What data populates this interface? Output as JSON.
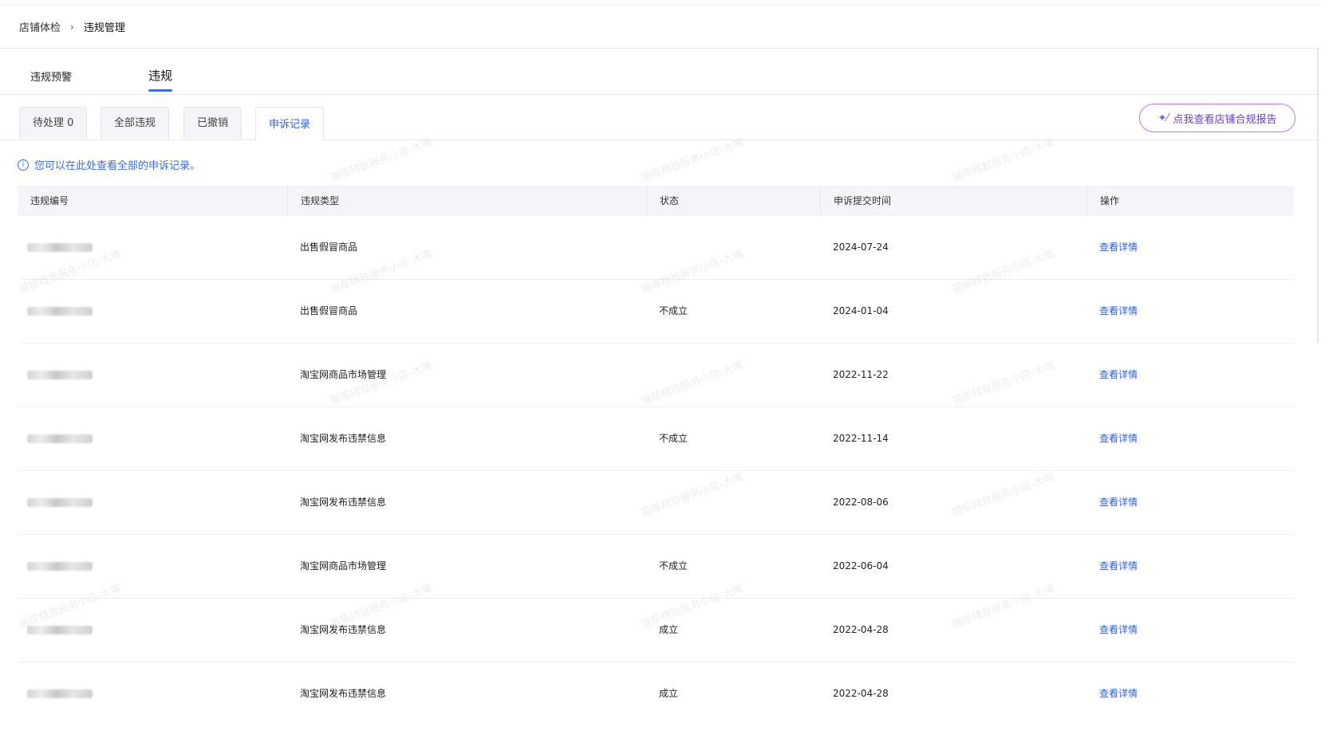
{
  "breadcrumb": {
    "item1": "店铺体检",
    "separator": "›",
    "item2": "违规管理"
  },
  "main_tabs": {
    "tab1": "违规预警",
    "tab2": "违规"
  },
  "sub_tabs": {
    "pending": "待处理 0",
    "all": "全部违规",
    "revoked": "已撤销",
    "appeals": "申诉记录"
  },
  "report_button": {
    "icon": "sparkle-icon",
    "label": "点我查看店铺合规报告"
  },
  "notice": {
    "icon": "info-icon",
    "text": "您可以在此处查看全部的申诉记录。"
  },
  "table": {
    "headers": [
      "违规编号",
      "违规类型",
      "状态",
      "申诉提交时间",
      "操作"
    ],
    "rows": [
      {
        "type": "出售假冒商品",
        "status": "",
        "time": "2024-07-24",
        "action": "查看详情"
      },
      {
        "type": "出售假冒商品",
        "status": "不成立",
        "time": "2024-01-04",
        "action": "查看详情"
      },
      {
        "type": "淘宝网商品市场管理",
        "status": "",
        "time": "2022-11-22",
        "action": "查看详情"
      },
      {
        "type": "淘宝网发布违禁信息",
        "status": "不成立",
        "time": "2022-11-14",
        "action": "查看详情"
      },
      {
        "type": "淘宝网发布违禁信息",
        "status": "",
        "time": "2022-08-06",
        "action": "查看详情"
      },
      {
        "type": "淘宝网商品市场管理",
        "status": "不成立",
        "time": "2022-06-04",
        "action": "查看详情"
      },
      {
        "type": "淘宝网发布违禁信息",
        "status": "成立",
        "time": "2022-04-28",
        "action": "查看详情"
      },
      {
        "type": "淘宝网发布违禁信息",
        "status": "成立",
        "time": "2022-04-28",
        "action": "查看详情"
      }
    ]
  },
  "watermark": "摄振精致服务小店-大嘴",
  "colors": {
    "accent": "#2f5ef0",
    "report_border": "#c47be0"
  }
}
